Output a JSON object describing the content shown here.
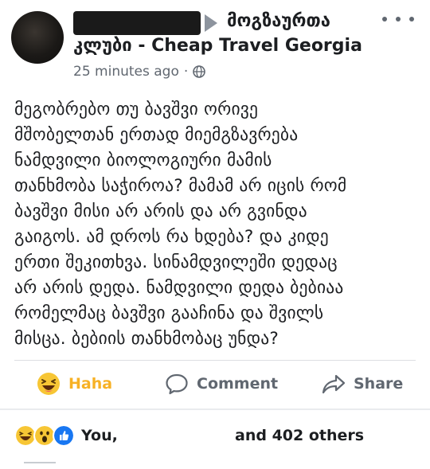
{
  "post": {
    "group_name_line1": "მოგზაურთა",
    "group_name_line2": "კლუბი - Cheap Travel Georgia",
    "timestamp": "25 minutes ago",
    "separator": "·",
    "body_lines": [
      "მეგობრებო თუ ბავშვი ორივე",
      "მშობელთან ერთად მიემგზავრება",
      "ნამდვილი ბიოლოგიური მამის",
      "თანხმობა საჭიროა? მამამ არ იცის რომ",
      "ბავშვი მისი არ არის და არ გვინდა",
      "გაიგოს. ამ დროს რა ხდება? და კიდე",
      "ერთი შეკითხვა. სინამდვილეში დედაც",
      "არ არის დედა. ნამდვილი დედა ბებიაა",
      "რომელმაც ბავშვი გააჩინა და შვილს",
      "მისცა. ბებიის თანხმობაც უნდა?"
    ]
  },
  "actions": {
    "haha_label": "Haha",
    "comment_label": "Comment",
    "share_label": "Share"
  },
  "reactions": {
    "you_label": "You,",
    "others_label": "and 402 others"
  },
  "icons": {
    "privacy": "globe-icon",
    "more": "more-options-icon",
    "haha": "haha-emoji-icon",
    "comment": "comment-icon",
    "share": "share-icon"
  },
  "colors": {
    "haha_accent": "#f7b125",
    "like_blue": "#1877f2",
    "muted_text": "#606770"
  }
}
